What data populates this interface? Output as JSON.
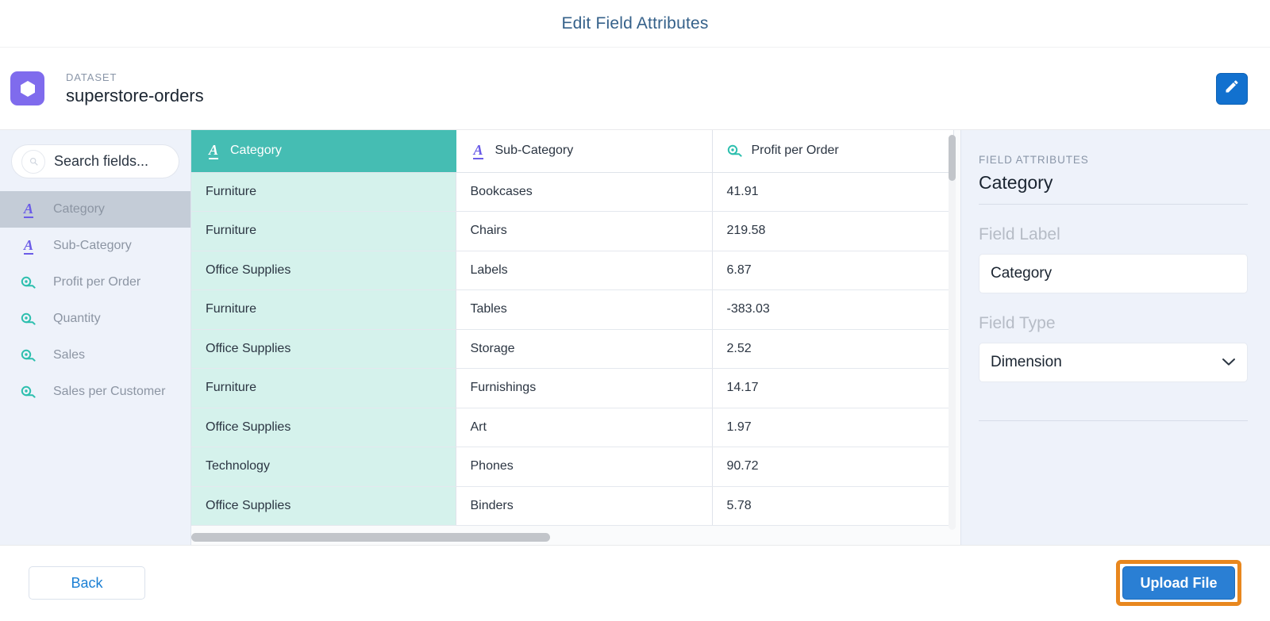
{
  "window": {
    "title": "Edit Field Attributes"
  },
  "dataset": {
    "kicker": "DATASET",
    "name": "superstore-orders",
    "icon": "dataset-hexagon-icon",
    "edit_icon": "pencil-icon"
  },
  "sidebar": {
    "search": {
      "placeholder": "Search fields...",
      "value": "",
      "icon": "search-icon"
    },
    "items": [
      {
        "label": "Category",
        "type": "text",
        "icon": "text-field-icon",
        "selected": true
      },
      {
        "label": "Sub-Category",
        "type": "text",
        "icon": "text-field-icon",
        "selected": false
      },
      {
        "label": "Profit per Order",
        "type": "measure",
        "icon": "measure-field-icon",
        "selected": false
      },
      {
        "label": "Quantity",
        "type": "measure",
        "icon": "measure-field-icon",
        "selected": false
      },
      {
        "label": "Sales",
        "type": "measure",
        "icon": "measure-field-icon",
        "selected": false
      },
      {
        "label": "Sales per Customer",
        "type": "measure",
        "icon": "measure-field-icon",
        "selected": false
      }
    ]
  },
  "table": {
    "columns": [
      {
        "label": "Category",
        "type": "text",
        "icon": "text-field-icon",
        "selected": true
      },
      {
        "label": "Sub-Category",
        "type": "text",
        "icon": "text-field-icon",
        "selected": false
      },
      {
        "label": "Profit per Order",
        "type": "measure",
        "icon": "measure-field-icon",
        "selected": false
      }
    ],
    "rows": [
      [
        "Furniture",
        "Bookcases",
        "41.91"
      ],
      [
        "Furniture",
        "Chairs",
        "219.58"
      ],
      [
        "Office Supplies",
        "Labels",
        "6.87"
      ],
      [
        "Furniture",
        "Tables",
        "-383.03"
      ],
      [
        "Office Supplies",
        "Storage",
        "2.52"
      ],
      [
        "Furniture",
        "Furnishings",
        "14.17"
      ],
      [
        "Office Supplies",
        "Art",
        "1.97"
      ],
      [
        "Technology",
        "Phones",
        "90.72"
      ],
      [
        "Office Supplies",
        "Binders",
        "5.78"
      ]
    ]
  },
  "attributes": {
    "kicker": "FIELD ATTRIBUTES",
    "field_name": "Category",
    "field_label_heading": "Field Label",
    "field_label_value": "Category",
    "field_type_heading": "Field Type",
    "field_type_value": "Dimension",
    "chevron_icon": "chevron-down-icon"
  },
  "footer": {
    "back_label": "Back",
    "upload_label": "Upload File"
  },
  "colors": {
    "selected_column": "#45bdb3",
    "selected_column_cell": "#d5f2ec",
    "text_field_icon": "#6b5ce7",
    "measure_field_icon": "#2dbfae",
    "primary_button": "#2a7fd4",
    "highlight_border": "#e8871e",
    "dataset_icon": "#7f6bed",
    "panel_bg": "#eef2fa"
  }
}
